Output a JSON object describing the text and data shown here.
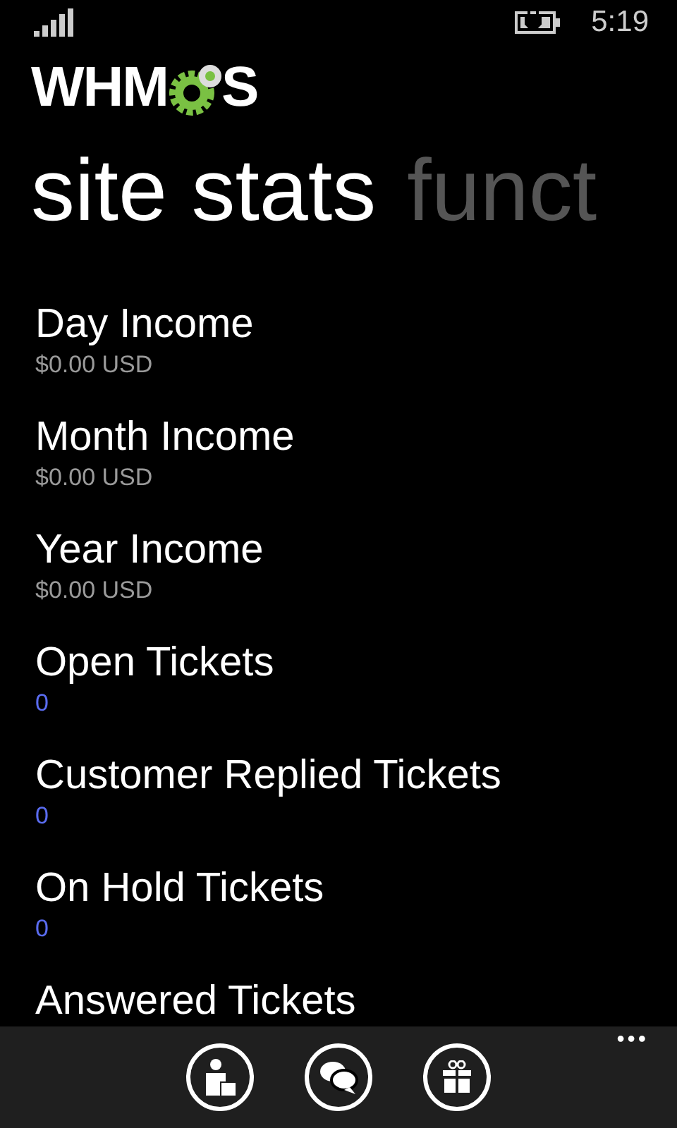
{
  "status_bar": {
    "time": "5:19"
  },
  "logo": {
    "left": "WHM",
    "right": "S"
  },
  "pivot": [
    {
      "label": "site stats",
      "selected": true
    },
    {
      "label": "funct",
      "selected": false
    }
  ],
  "stats": [
    {
      "label": "Day Income",
      "value": "$0.00 USD",
      "kind": "money"
    },
    {
      "label": "Month Income",
      "value": "$0.00 USD",
      "kind": "money"
    },
    {
      "label": "Year Income",
      "value": "$0.00 USD",
      "kind": "money"
    },
    {
      "label": "Open Tickets",
      "value": "0",
      "kind": "count"
    },
    {
      "label": "Customer Replied Tickets",
      "value": "0",
      "kind": "count"
    },
    {
      "label": "On Hold Tickets",
      "value": "0",
      "kind": "count"
    },
    {
      "label": "Answered Tickets"
    }
  ],
  "app_bar": {
    "more": "•••"
  }
}
